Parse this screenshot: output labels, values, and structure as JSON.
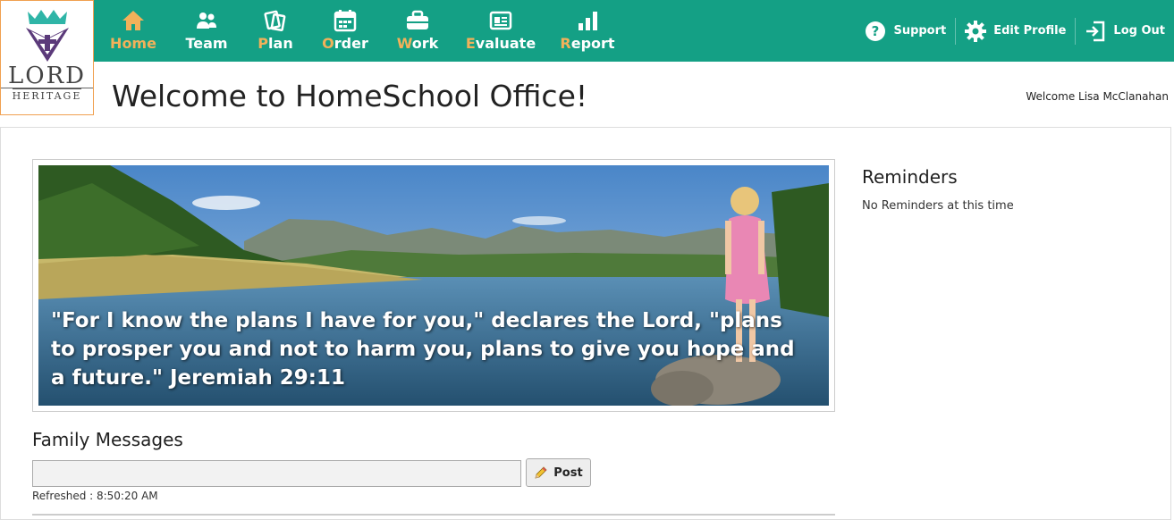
{
  "brand": {
    "line1": "LORD",
    "line2": "HERITAGE"
  },
  "nav": {
    "items": [
      {
        "first": "H",
        "rest": "ome",
        "icon": "home-icon",
        "active": true
      },
      {
        "first": "T",
        "rest": "eam",
        "icon": "team-icon",
        "active": false
      },
      {
        "first": "P",
        "rest": "lan",
        "icon": "plan-icon",
        "active": false
      },
      {
        "first": "O",
        "rest": "rder",
        "icon": "order-icon",
        "active": false
      },
      {
        "first": "W",
        "rest": "ork",
        "icon": "work-icon",
        "active": false
      },
      {
        "first": "E",
        "rest": "valuate",
        "icon": "evaluate-icon",
        "active": false
      },
      {
        "first": "R",
        "rest": "eport",
        "icon": "report-icon",
        "active": false
      }
    ]
  },
  "utils": {
    "support": "Support",
    "edit_profile": "Edit Profile",
    "logout": "Log Out"
  },
  "page": {
    "title": "Welcome to HomeSchool Office!",
    "welcome_user": "Welcome Lisa McClanahan"
  },
  "hero": {
    "quote": "\"For I know the plans I have for you,\" declares the Lord, \"plans to prosper you and not to harm you, plans to give you hope and a future.\" Jeremiah 29:11"
  },
  "reminders": {
    "title": "Reminders",
    "empty": "No Reminders at this time"
  },
  "family_messages": {
    "title": "Family Messages",
    "input_value": "",
    "post_label": "Post",
    "refreshed": "Refreshed : 8:50:20 AM"
  },
  "colors": {
    "topbar": "#14a085",
    "accent": "#f2b15a"
  }
}
